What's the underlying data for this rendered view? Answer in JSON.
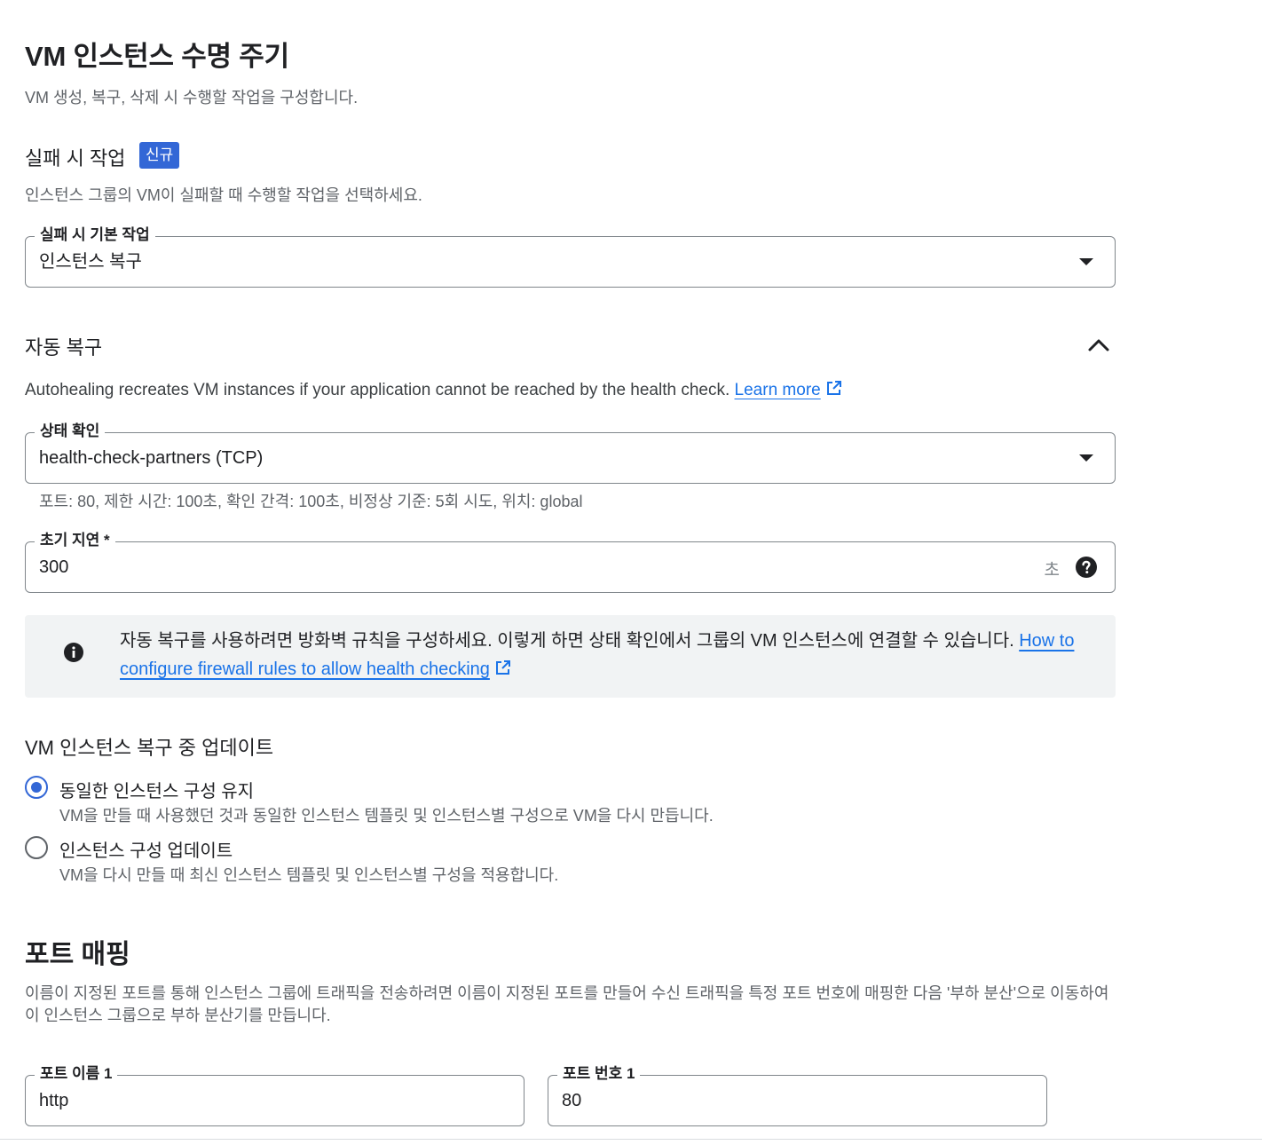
{
  "header": {
    "title": "VM 인스턴스 수명 주기",
    "subtitle": "VM 생성, 복구, 삭제 시 수행할 작업을 구성합니다."
  },
  "failure_action": {
    "title": "실패 시 작업",
    "badge": "신규",
    "description": "인스턴스 그룹의 VM이 실패할 때 수행할 작업을 선택하세요.",
    "field_label": "실패 시 기본 작업",
    "field_value": "인스턴스 복구"
  },
  "autohealing": {
    "title": "자동 복구",
    "description": "Autohealing recreates VM instances if your application cannot be reached by the health check.",
    "learn_more": "Learn more",
    "health_check": {
      "label": "상태 확인",
      "value": "health-check-partners (TCP)",
      "hint": "포트: 80, 제한 시간: 100초, 확인 간격: 100초, 비정상 기준: 5회 시도, 위치: global"
    },
    "initial_delay": {
      "label": "초기 지연 *",
      "value": "300",
      "unit": "초"
    },
    "info": {
      "text": "자동 복구를 사용하려면 방화벽 규칙을 구성하세요. 이렇게 하면 상태 확인에서 그룹의 VM 인스턴스에 연결할 수 있습니다. ",
      "link_line1": "How to",
      "link_line2": "configure firewall rules to allow health checking"
    }
  },
  "update_during_repair": {
    "title": "VM 인스턴스 복구 중 업데이트",
    "options": [
      {
        "label": "동일한 인스턴스 구성 유지",
        "description": "VM을 만들 때 사용했던 것과 동일한 인스턴스 템플릿 및 인스턴스별 구성으로 VM을 다시 만듭니다.",
        "selected": true
      },
      {
        "label": "인스턴스 구성 업데이트",
        "description": "VM을 다시 만들 때 최신 인스턴스 템플릿 및 인스턴스별 구성을 적용합니다.",
        "selected": false
      }
    ]
  },
  "port_mapping": {
    "title": "포트 매핑",
    "description_line1": "이름이 지정된 포트를 통해 인스턴스 그룹에 트래픽을 전송하려면 이름이 지정된 포트를 만들어 수신 트래픽을 특정 포트 번호에 매핑한 다음 '부하 분산'으로 이동하여",
    "description_line2": "이 인스턴스 그룹으로 부하 분산기를 만듭니다.",
    "port_name": {
      "label": "포트 이름 1",
      "value": "http"
    },
    "port_number": {
      "label": "포트 번호 1",
      "value": "80"
    }
  },
  "colors": {
    "accent": "#3367d6",
    "link": "#1a73e8",
    "info_bg": "#f1f3f4"
  },
  "icons": {
    "dropdown": "caret-down-icon",
    "collapse": "chevron-up-icon",
    "external_link": "external-link-icon",
    "help": "help-circle-icon",
    "info": "info-circle-icon"
  }
}
